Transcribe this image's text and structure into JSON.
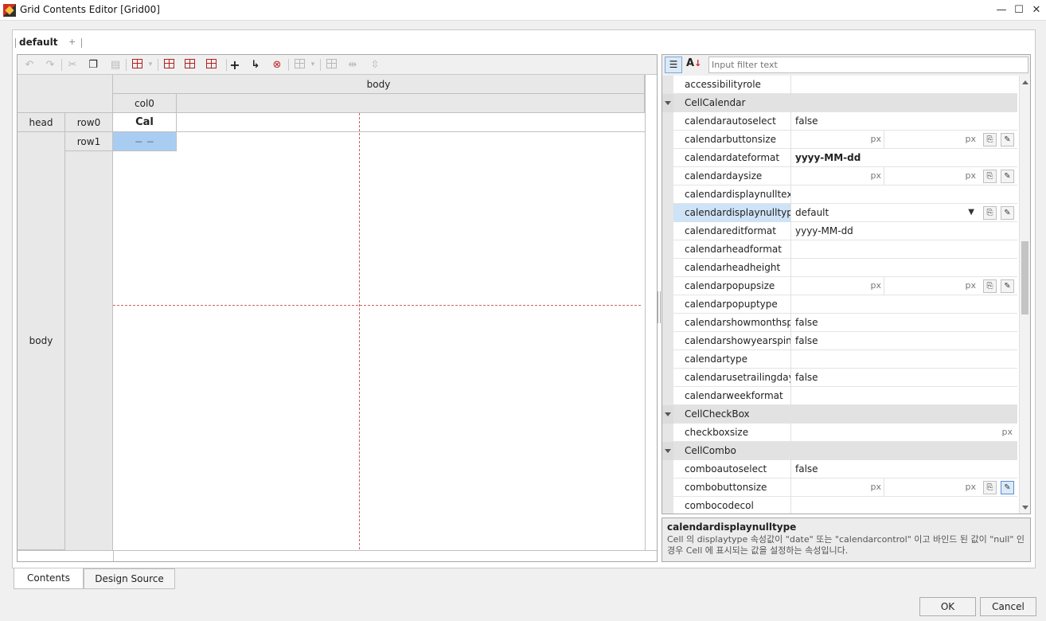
{
  "window": {
    "title": "Grid Contents Editor [Grid00]",
    "min": "—",
    "max": "☐",
    "close": "✕"
  },
  "tabs": {
    "default": "default",
    "add": "+"
  },
  "grid": {
    "body_header": "body",
    "col0": "col0",
    "head": "head",
    "row0": "row0",
    "cal": "Cal",
    "row1": "row1",
    "row1_cell": "－ －",
    "body_left": "body"
  },
  "filter_placeholder": "Input filter text",
  "px": "px",
  "props": [
    {
      "type": "prop",
      "name": "accessibilityrole",
      "value": ""
    },
    {
      "type": "cat",
      "name": "CellCalendar"
    },
    {
      "type": "prop",
      "name": "calendarautoselect",
      "value": "false"
    },
    {
      "type": "size",
      "name": "calendarbuttonsize"
    },
    {
      "type": "prop",
      "name": "calendardateformat",
      "value": "yyyy-MM-dd",
      "bold": true
    },
    {
      "type": "size",
      "name": "calendardaysize"
    },
    {
      "type": "prop",
      "name": "calendardisplaynulltext",
      "value": ""
    },
    {
      "type": "combo",
      "name": "calendardisplaynulltype",
      "value": "default",
      "selected": true
    },
    {
      "type": "prop",
      "name": "calendareditformat",
      "value": "yyyy-MM-dd"
    },
    {
      "type": "prop",
      "name": "calendarheadformat",
      "value": ""
    },
    {
      "type": "prop",
      "name": "calendarheadheight",
      "value": ""
    },
    {
      "type": "size",
      "name": "calendarpopupsize"
    },
    {
      "type": "prop",
      "name": "calendarpopuptype",
      "value": ""
    },
    {
      "type": "prop",
      "name": "calendarshowmonthspin",
      "value": "false"
    },
    {
      "type": "prop",
      "name": "calendarshowyearspin",
      "value": "false"
    },
    {
      "type": "prop",
      "name": "calendartype",
      "value": ""
    },
    {
      "type": "prop",
      "name": "calendarusetrailingday",
      "value": "false"
    },
    {
      "type": "prop",
      "name": "calendarweekformat",
      "value": ""
    },
    {
      "type": "cat",
      "name": "CellCheckBox"
    },
    {
      "type": "pxonly",
      "name": "checkboxsize"
    },
    {
      "type": "cat",
      "name": "CellCombo"
    },
    {
      "type": "prop",
      "name": "comboautoselect",
      "value": "false"
    },
    {
      "type": "size",
      "name": "combobuttonsize",
      "highlight": true
    },
    {
      "type": "prop",
      "name": "combocodecol",
      "value": ""
    }
  ],
  "description": {
    "title": "calendardisplaynulltype",
    "text": "Cell 의 displaytype 속성값이 \"date\" 또는 \"calendarcontrol\" 이고 바인드 된 값이 \"null\" 인 경우 Cell 에 표시되는 값을 설정하는 속성입니다."
  },
  "bottom_tabs": {
    "contents": "Contents",
    "design_source": "Design Source"
  },
  "buttons": {
    "ok": "OK",
    "cancel": "Cancel"
  }
}
